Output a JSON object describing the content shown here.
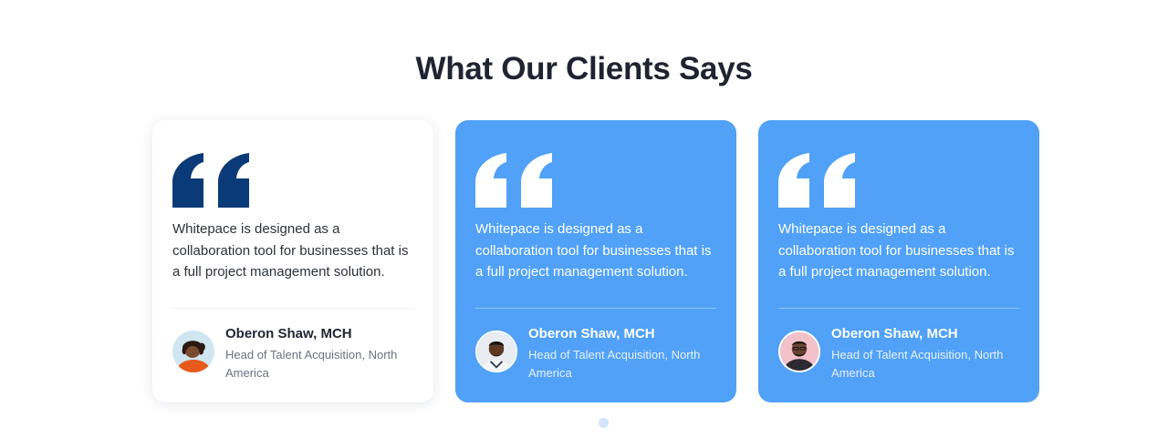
{
  "section": {
    "title": "What Our Clients Says"
  },
  "colors": {
    "card_blue": "#50a1f7",
    "quote_dark": "#0b3a78",
    "title": "#1f2430"
  },
  "testimonials": [
    {
      "style": "light",
      "quote_icon": "quote-icon",
      "text": "Whitepace is designed as a collaboration tool for businesses that is a full project management solution.",
      "name": "Oberon Shaw, MCH",
      "role": "Head of Talent Acquisition, North America",
      "avatar_icon": "avatar"
    },
    {
      "style": "blue",
      "quote_icon": "quote-icon",
      "text": "Whitepace is designed as a collaboration tool for businesses that is a full project management solution.",
      "name": "Oberon Shaw, MCH",
      "role": "Head of Talent Acquisition, North America",
      "avatar_icon": "avatar"
    },
    {
      "style": "blue",
      "quote_icon": "quote-icon",
      "text": "Whitepace is designed as a collaboration tool for businesses that is a full project management solution.",
      "name": "Oberon Shaw, MCH",
      "role": "Head of Talent Acquisition, North America",
      "avatar_icon": "avatar"
    }
  ],
  "carousel": {
    "dots": 1,
    "active_index": 0
  }
}
